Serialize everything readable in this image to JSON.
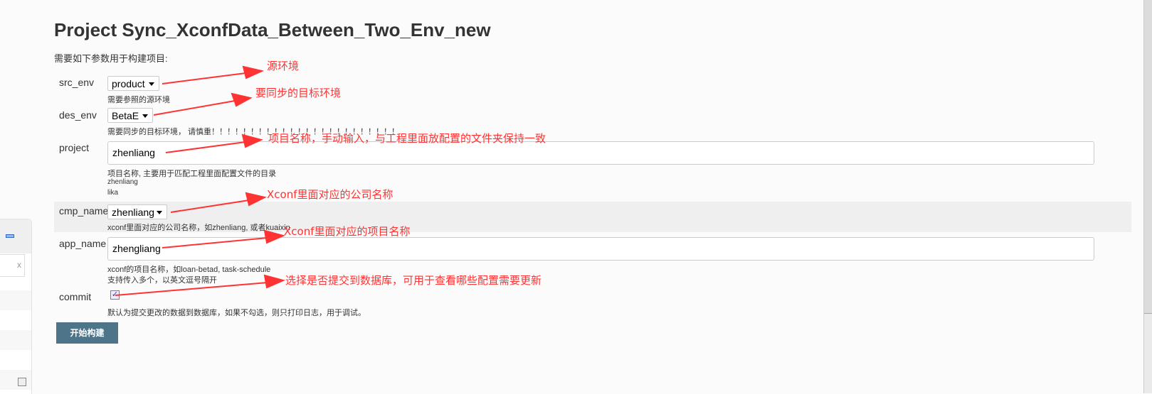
{
  "title": "Project Sync_XconfData_Between_Two_Env_new",
  "intro": "需要如下参数用于构建项目:",
  "params": {
    "src_env": {
      "label": "src_env",
      "value": "product",
      "desc": "需要参照的源环境"
    },
    "des_env": {
      "label": "des_env",
      "value": "BetaE",
      "desc": "需要同步的目标环境， 请慎重！！！！！！！！！！！！！！！！！！！！！！！！"
    },
    "project": {
      "label": "project",
      "value": "zhenliang",
      "desc": "项目名称, 主要用于匹配工程里面配置文件的目录",
      "desc2": "zhenliang",
      "desc3": "lika"
    },
    "cmp_name": {
      "label": "cmp_name",
      "value": "zhenliang",
      "desc": "xconf里面对应的公司名称，如zhenliang, 或者kuaixin"
    },
    "app_name": {
      "label": "app_name",
      "value": "zhengliang",
      "desc": "xconf的项目名称，如loan-betad, task-schedule",
      "desc2": "支持传入多个，以英文逗号隔开"
    },
    "commit": {
      "label": "commit",
      "checked": true,
      "desc": "默认为提交更改的数据到数据库，如果不勾选，则只打印日志，用于调试。"
    }
  },
  "build_button": "开始构建",
  "annotations": [
    "源环境",
    "要同步的目标环境",
    "项目名称，手动输入，与工程里面放配置的文件夹保持一致",
    "Xconf里面对应的公司名称",
    "Xconf里面对应的项目名称",
    "选择是否提交到数据库，可用于查看哪些配置需要更新"
  ],
  "sidebar": {
    "clear": "x"
  },
  "colors": {
    "annotation": "#ff3333",
    "button": "#4d7488",
    "band": "#efefef"
  }
}
